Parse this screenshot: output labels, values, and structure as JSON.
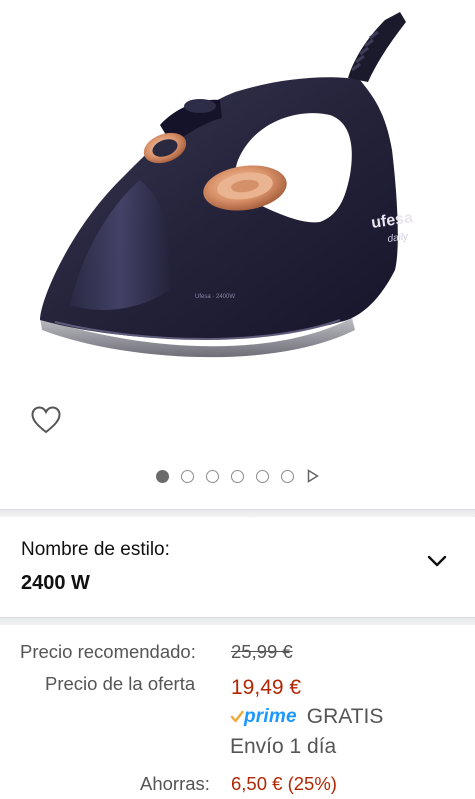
{
  "product": {
    "brand_logo_text": "ufesa",
    "brand_sub_text": "daily"
  },
  "carousel": {
    "total_images": 6,
    "active_index": 0
  },
  "style": {
    "label": "Nombre de estilo:",
    "value": "2400 W"
  },
  "pricing": {
    "recommended_label": "Precio recomendado:",
    "recommended_value": "25,99 €",
    "deal_label": "Precio de la oferta",
    "deal_value": "19,49 €",
    "prime_text": "prime",
    "shipping_free": "GRATIS",
    "shipping_time": "Envío 1 día",
    "savings_label": "Ahorras:",
    "savings_value": "6,50 € (25%)"
  },
  "colors": {
    "price_red": "#b12704",
    "prime_blue": "#1a98ff",
    "prime_check": "#f0a93b",
    "iron_body": "#23223a",
    "iron_copper": "#d9926a"
  },
  "icons": [
    "heart-outline-icon",
    "chevron-down-icon",
    "carousel-next-arrow-icon",
    "prime-check-icon"
  ]
}
